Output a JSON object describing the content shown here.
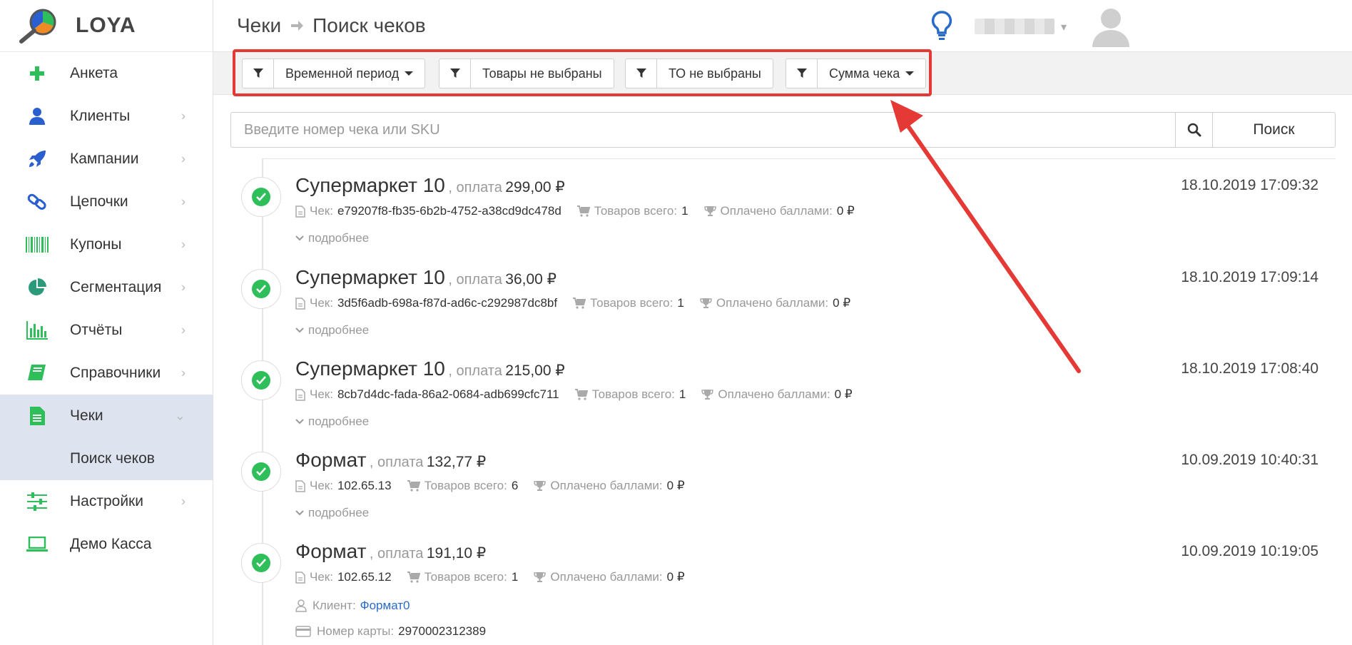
{
  "app": {
    "logo_text": "LOYA"
  },
  "sidebar": {
    "items": [
      {
        "label": "Анкета",
        "icon": "plus-icon",
        "color": "#2fbf5a",
        "has_chevron": false
      },
      {
        "label": "Клиенты",
        "icon": "user-icon",
        "color": "#2a5fcf",
        "has_chevron": true
      },
      {
        "label": "Кампании",
        "icon": "rocket-icon",
        "color": "#2a5fcf",
        "has_chevron": true
      },
      {
        "label": "Цепочки",
        "icon": "link-icon",
        "color": "#2a5fcf",
        "has_chevron": true
      },
      {
        "label": "Купоны",
        "icon": "barcode-icon",
        "color": "#2fbf5a",
        "has_chevron": true
      },
      {
        "label": "Сегментация",
        "icon": "pie-icon",
        "color": "#2a9a7a",
        "has_chevron": true
      },
      {
        "label": "Отчёты",
        "icon": "bar-chart-icon",
        "color": "#2fbf5a",
        "has_chevron": true
      },
      {
        "label": "Справочники",
        "icon": "book-icon",
        "color": "#2fbf5a",
        "has_chevron": true
      },
      {
        "label": "Чеки",
        "icon": "document-icon",
        "color": "#2fbf5a",
        "has_chevron": true
      },
      {
        "label": "Настройки",
        "icon": "sliders-icon",
        "color": "#2fbf5a",
        "has_chevron": true
      },
      {
        "label": "Демо Касса",
        "icon": "laptop-icon",
        "color": "#2fbf5a",
        "has_chevron": false
      }
    ],
    "sub_item": "Поиск чеков"
  },
  "header": {
    "crumb_1": "Чеки",
    "crumb_2": "Поиск чеков"
  },
  "filters": {
    "period": "Временной период",
    "goods": "Товары не выбраны",
    "outlets": "ТО не выбраны",
    "sum": "Сумма чека"
  },
  "search": {
    "placeholder": "Введите номер чека или SKU",
    "button": "Поиск"
  },
  "labels": {
    "pay": ", оплата",
    "check": "Чек:",
    "goods_total": "Товаров всего:",
    "paid_points": "Оплачено баллами:",
    "more": "подробнее",
    "client": "Клиент:",
    "card_number": "Номер карты:"
  },
  "receipts": [
    {
      "store": "Супермаркет 10",
      "amount": "299,00 ₽",
      "check": "e79207f8-fb35-6b2b-4752-a38cd9dc478d",
      "goods": "1",
      "points": "0 ₽",
      "date": "18.10.2019 17:09:32"
    },
    {
      "store": "Супермаркет 10",
      "amount": "36,00 ₽",
      "check": "3d5f6adb-698a-f87d-ad6c-c292987dc8bf",
      "goods": "1",
      "points": "0 ₽",
      "date": "18.10.2019 17:09:14"
    },
    {
      "store": "Супермаркет 10",
      "amount": "215,00 ₽",
      "check": "8cb7d4dc-fada-86a2-0684-adb699cfc711",
      "goods": "1",
      "points": "0 ₽",
      "date": "18.10.2019 17:08:40"
    },
    {
      "store": "Формат",
      "amount": "132,77 ₽",
      "check": "102.65.13",
      "goods": "6",
      "points": "0 ₽",
      "date": "10.09.2019 10:40:31"
    },
    {
      "store": "Формат",
      "amount": "191,10 ₽",
      "check": "102.65.12",
      "goods": "1",
      "points": "0 ₽",
      "date": "10.09.2019 10:19:05",
      "client": "Формат0",
      "card": "2970002312389"
    }
  ]
}
